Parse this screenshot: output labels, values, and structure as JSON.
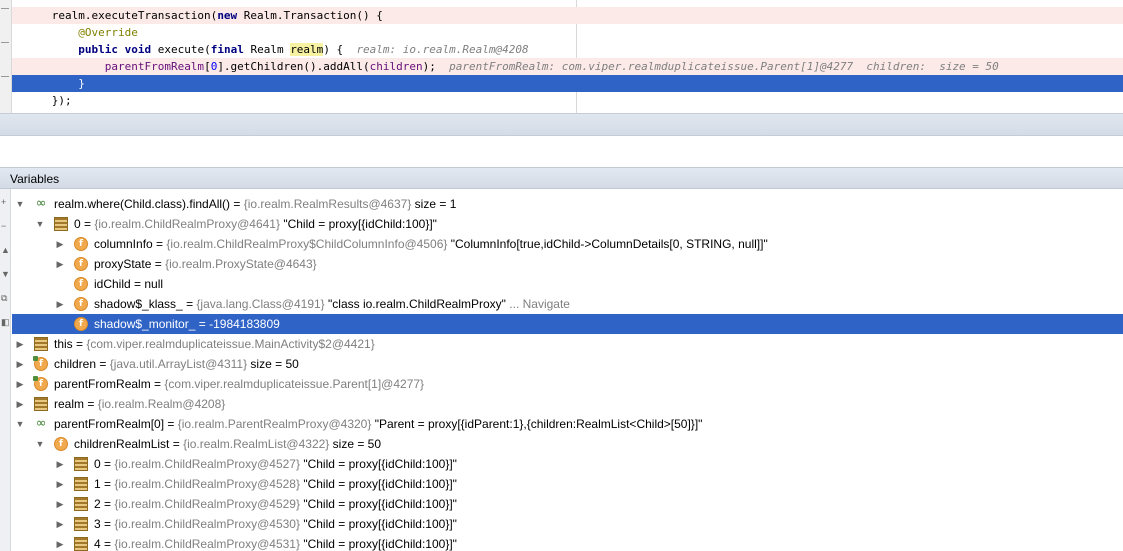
{
  "editor": {
    "lines": [
      {
        "parts": [
          {
            "t": "      realm.executeTransaction(",
            "c": ""
          },
          {
            "t": "new",
            "c": "kw"
          },
          {
            "t": " Realm.Transaction() {",
            "c": ""
          }
        ]
      },
      {
        "parts": [
          {
            "t": "          ",
            "c": ""
          },
          {
            "t": "@Override",
            "c": "ann"
          }
        ]
      },
      {
        "parts": [
          {
            "t": "          ",
            "c": ""
          },
          {
            "t": "public void",
            "c": "kw"
          },
          {
            "t": " execute(",
            "c": ""
          },
          {
            "t": "final",
            "c": "kw"
          },
          {
            "t": " Realm ",
            "c": ""
          },
          {
            "t": "realm",
            "c": "hl"
          },
          {
            "t": ") {  ",
            "c": ""
          },
          {
            "t": "realm: io.realm.Realm@4208",
            "c": "inl"
          }
        ]
      },
      {
        "parts": [
          {
            "t": "              ",
            "c": ""
          },
          {
            "t": "parentFromRealm",
            "c": "fld"
          },
          {
            "t": "[",
            "c": ""
          },
          {
            "t": "0",
            "c": "num"
          },
          {
            "t": "].getChildren().addAll(",
            "c": ""
          },
          {
            "t": "children",
            "c": "fld"
          },
          {
            "t": ");  ",
            "c": ""
          },
          {
            "t": "parentFromRealm: com.viper.realmduplicateissue.Parent[1]@4277  children:  size = 50",
            "c": "inl"
          }
        ]
      },
      {
        "parts": [
          {
            "t": "          }",
            "c": ""
          }
        ]
      },
      {
        "parts": [
          {
            "t": "      });",
            "c": ""
          }
        ]
      }
    ]
  },
  "panel": {
    "title": "Variables"
  },
  "tree": [
    {
      "arrow": "▼",
      "icon": "watch",
      "name": "realm.where(Child.class).findAll()",
      "ref": "{io.realm.RealmResults@4637}",
      "value": " size = 1"
    },
    {
      "arrow": "▼",
      "icon": "lines",
      "name": "0",
      "ref": "{io.realm.ChildRealmProxy@4641}",
      "value": " \"Child = proxy[{idChild:100}]\""
    },
    {
      "arrow": "▶",
      "icon": "field",
      "name": "columnInfo",
      "ref": "{io.realm.ChildRealmProxy$ChildColumnInfo@4506}",
      "value": " \"ColumnInfo[true,idChild->ColumnDetails[0, STRING, null]]\""
    },
    {
      "arrow": "▶",
      "icon": "field",
      "name": "proxyState",
      "ref": "{io.realm.ProxyState@4643}",
      "value": ""
    },
    {
      "arrow": "",
      "icon": "field",
      "name": "idChild",
      "ref": "",
      "value": "null"
    },
    {
      "arrow": "▶",
      "icon": "field",
      "name": "shadow$_klass_",
      "ref": "{java.lang.Class@4191}",
      "value": " \"class io.realm.ChildRealmProxy\"",
      "nav": " ... Navigate"
    },
    {
      "arrow": "",
      "icon": "field",
      "name": "shadow$_monitor_",
      "ref": "",
      "value": "-1984183809"
    },
    {
      "arrow": "▶",
      "icon": "lines",
      "name": "this",
      "ref": "{com.viper.realmduplicateissue.MainActivity$2@4421}",
      "value": ""
    },
    {
      "arrow": "▶",
      "icon": "field-final",
      "name": "children",
      "ref": "{java.util.ArrayList@4311}",
      "value": " size = 50"
    },
    {
      "arrow": "▶",
      "icon": "field-final",
      "name": "parentFromRealm",
      "ref": "{com.viper.realmduplicateissue.Parent[1]@4277}",
      "value": ""
    },
    {
      "arrow": "▶",
      "icon": "lines",
      "name": "realm",
      "ref": "{io.realm.Realm@4208}",
      "value": ""
    },
    {
      "arrow": "▼",
      "icon": "watch",
      "name": "parentFromRealm[0]",
      "ref": "{io.realm.ParentRealmProxy@4320}",
      "value": " \"Parent = proxy[{idParent:1},{children:RealmList<Child>[50]}]\""
    },
    {
      "arrow": "▼",
      "icon": "field",
      "name": "childrenRealmList",
      "ref": "{io.realm.RealmList@4322}",
      "value": " size = 50"
    },
    {
      "arrow": "▶",
      "icon": "lines",
      "name": "0",
      "ref": "{io.realm.ChildRealmProxy@4527}",
      "value": " \"Child = proxy[{idChild:100}]\""
    },
    {
      "arrow": "▶",
      "icon": "lines",
      "name": "1",
      "ref": "{io.realm.ChildRealmProxy@4528}",
      "value": " \"Child = proxy[{idChild:100}]\""
    },
    {
      "arrow": "▶",
      "icon": "lines",
      "name": "2",
      "ref": "{io.realm.ChildRealmProxy@4529}",
      "value": " \"Child = proxy[{idChild:100}]\""
    },
    {
      "arrow": "▶",
      "icon": "lines",
      "name": "3",
      "ref": "{io.realm.ChildRealmProxy@4530}",
      "value": " \"Child = proxy[{idChild:100}]\""
    },
    {
      "arrow": "▶",
      "icon": "lines",
      "name": "4",
      "ref": "{io.realm.ChildRealmProxy@4531}",
      "value": " \"Child = proxy[{idChild:100}]\""
    }
  ]
}
